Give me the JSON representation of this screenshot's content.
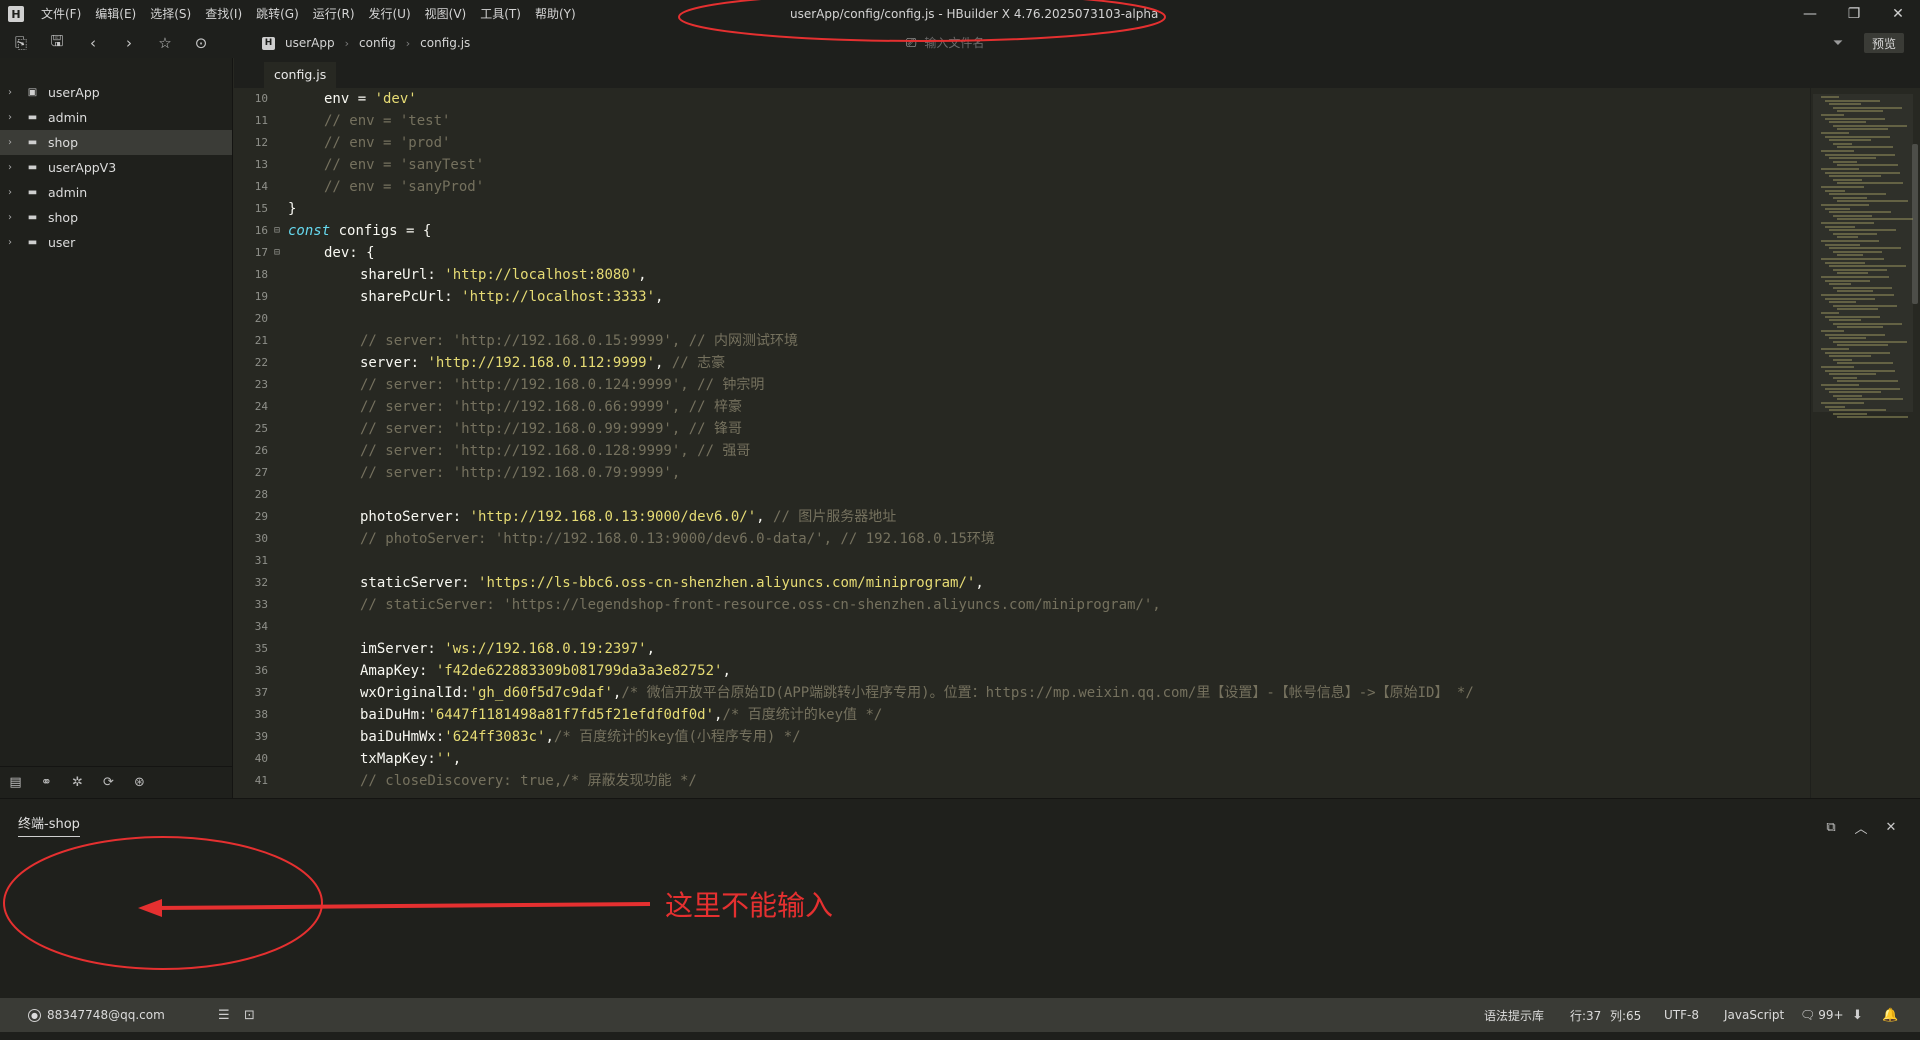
{
  "window": {
    "title": "userApp/config/config.js - HBuilder X 4.76.2025073103-alpha",
    "logo_letter": "H",
    "minimize": "—",
    "restore": "❐",
    "close": "✕"
  },
  "menu": [
    "文件(F)",
    "编辑(E)",
    "选择(S)",
    "查找(I)",
    "跳转(G)",
    "运行(R)",
    "发行(U)",
    "视图(V)",
    "工具(T)",
    "帮助(Y)"
  ],
  "toolbar": {
    "breadcrumb": [
      "userApp",
      "config",
      "config.js"
    ],
    "file_search_placeholder": "输入文件名",
    "preview_label": "预览"
  },
  "sidebar": {
    "items": [
      {
        "label": "userApp",
        "icon": "project-icon",
        "active": false
      },
      {
        "label": "admin",
        "icon": "folder-icon",
        "active": false
      },
      {
        "label": "shop",
        "icon": "folder-icon",
        "active": true
      },
      {
        "label": "userAppV3",
        "icon": "folder-icon",
        "active": false
      },
      {
        "label": "admin",
        "icon": "folder-icon",
        "active": false
      },
      {
        "label": "shop",
        "icon": "folder-icon",
        "active": false
      },
      {
        "label": "user",
        "icon": "folder-icon",
        "active": false
      }
    ]
  },
  "editor": {
    "tab": "config.js",
    "lines": [
      {
        "n": "10",
        "fold": "",
        "indent": 2,
        "parts": [
          [
            "k",
            "env = "
          ],
          [
            "s",
            "'dev'"
          ]
        ]
      },
      {
        "n": "11",
        "fold": "",
        "indent": 2,
        "parts": [
          [
            "c",
            "// env = 'test'"
          ]
        ]
      },
      {
        "n": "12",
        "fold": "",
        "indent": 2,
        "parts": [
          [
            "c",
            "// env = 'prod'"
          ]
        ]
      },
      {
        "n": "13",
        "fold": "",
        "indent": 2,
        "parts": [
          [
            "c",
            "// env = 'sanyTest'"
          ]
        ]
      },
      {
        "n": "14",
        "fold": "",
        "indent": 2,
        "parts": [
          [
            "c",
            "// env = 'sanyProd'"
          ]
        ]
      },
      {
        "n": "15",
        "fold": "",
        "indent": 0,
        "parts": [
          [
            "k",
            "}"
          ]
        ]
      },
      {
        "n": "16",
        "fold": "⊟",
        "indent": 0,
        "parts": [
          [
            "w",
            "const"
          ],
          [
            "k",
            " configs = {"
          ]
        ]
      },
      {
        "n": "17",
        "fold": "⊟",
        "indent": 2,
        "parts": [
          [
            "k",
            "dev: {"
          ]
        ]
      },
      {
        "n": "18",
        "fold": "",
        "indent": 4,
        "parts": [
          [
            "k",
            "shareUrl: "
          ],
          [
            "s",
            "'http://localhost:8080'"
          ],
          [
            "k",
            ","
          ]
        ]
      },
      {
        "n": "19",
        "fold": "",
        "indent": 4,
        "parts": [
          [
            "k",
            "sharePcUrl: "
          ],
          [
            "s",
            "'http://localhost:3333'"
          ],
          [
            "k",
            ","
          ]
        ]
      },
      {
        "n": "20",
        "fold": "",
        "indent": 0,
        "parts": []
      },
      {
        "n": "21",
        "fold": "",
        "indent": 4,
        "parts": [
          [
            "c",
            "// server: 'http://192.168.0.15:9999', // 内网测试环境"
          ]
        ]
      },
      {
        "n": "22",
        "fold": "",
        "indent": 4,
        "parts": [
          [
            "k",
            "server: "
          ],
          [
            "s",
            "'http://192.168.0.112:9999'"
          ],
          [
            "k",
            ", "
          ],
          [
            "c",
            "// 志豪"
          ]
        ]
      },
      {
        "n": "23",
        "fold": "",
        "indent": 4,
        "parts": [
          [
            "c",
            "// server: 'http://192.168.0.124:9999', // 钟宗明"
          ]
        ]
      },
      {
        "n": "24",
        "fold": "",
        "indent": 4,
        "parts": [
          [
            "c",
            "// server: 'http://192.168.0.66:9999', // 梓豪"
          ]
        ]
      },
      {
        "n": "25",
        "fold": "",
        "indent": 4,
        "parts": [
          [
            "c",
            "// server: 'http://192.168.0.99:9999', // 锋哥"
          ]
        ]
      },
      {
        "n": "26",
        "fold": "",
        "indent": 4,
        "parts": [
          [
            "c",
            "// server: 'http://192.168.0.128:9999', // 强哥"
          ]
        ]
      },
      {
        "n": "27",
        "fold": "",
        "indent": 4,
        "parts": [
          [
            "c",
            "// server: 'http://192.168.0.79:9999',"
          ]
        ]
      },
      {
        "n": "28",
        "fold": "",
        "indent": 0,
        "parts": []
      },
      {
        "n": "29",
        "fold": "",
        "indent": 4,
        "parts": [
          [
            "k",
            "photoServer: "
          ],
          [
            "s",
            "'http://192.168.0.13:9000/dev6.0/'"
          ],
          [
            "k",
            ", "
          ],
          [
            "c",
            "// 图片服务器地址"
          ]
        ]
      },
      {
        "n": "30",
        "fold": "",
        "indent": 4,
        "parts": [
          [
            "c",
            "// photoServer: 'http://192.168.0.13:9000/dev6.0-data/', // 192.168.0.15环境"
          ]
        ]
      },
      {
        "n": "31",
        "fold": "",
        "indent": 0,
        "parts": []
      },
      {
        "n": "32",
        "fold": "",
        "indent": 4,
        "parts": [
          [
            "k",
            "staticServer: "
          ],
          [
            "s",
            "'https://ls-bbc6.oss-cn-shenzhen.aliyuncs.com/miniprogram/'"
          ],
          [
            "k",
            ","
          ]
        ]
      },
      {
        "n": "33",
        "fold": "",
        "indent": 4,
        "parts": [
          [
            "c",
            "// staticServer: 'https://legendshop-front-resource.oss-cn-shenzhen.aliyuncs.com/miniprogram/',"
          ]
        ]
      },
      {
        "n": "34",
        "fold": "",
        "indent": 0,
        "parts": []
      },
      {
        "n": "35",
        "fold": "",
        "indent": 4,
        "parts": [
          [
            "k",
            "imServer: "
          ],
          [
            "s",
            "'ws://192.168.0.19:2397'"
          ],
          [
            "k",
            ","
          ]
        ]
      },
      {
        "n": "36",
        "fold": "",
        "indent": 4,
        "parts": [
          [
            "k",
            "AmapKey: "
          ],
          [
            "s",
            "'f42de622883309b081799da3a3e82752'"
          ],
          [
            "k",
            ","
          ]
        ]
      },
      {
        "n": "37",
        "fold": "",
        "indent": 4,
        "parts": [
          [
            "k",
            "wxOriginalId:"
          ],
          [
            "s",
            "'gh_d60f5d7c9daf'"
          ],
          [
            "k",
            ","
          ],
          [
            "c",
            "/* 微信开放平台原始ID(APP端跳转小程序专用)。位置：https://mp.weixin.qq.com/里【设置】-【帐号信息】->【原始ID】 */"
          ]
        ]
      },
      {
        "n": "38",
        "fold": "",
        "indent": 4,
        "parts": [
          [
            "k",
            "baiDuHm:"
          ],
          [
            "s",
            "'6447f1181498a81f7fd5f21efdf0df0d'"
          ],
          [
            "k",
            ","
          ],
          [
            "c",
            "/* 百度统计的key值 */"
          ]
        ]
      },
      {
        "n": "39",
        "fold": "",
        "indent": 4,
        "parts": [
          [
            "k",
            "baiDuHmWx:"
          ],
          [
            "s",
            "'624ff3083c'"
          ],
          [
            "k",
            ","
          ],
          [
            "c",
            "/* 百度统计的key值(小程序专用) */"
          ]
        ]
      },
      {
        "n": "40",
        "fold": "",
        "indent": 4,
        "parts": [
          [
            "k",
            "txMapKey:"
          ],
          [
            "s",
            "''"
          ],
          [
            "k",
            ","
          ]
        ]
      },
      {
        "n": "41",
        "fold": "",
        "indent": 4,
        "parts": [
          [
            "c",
            "// closeDiscovery: true,/* 屏蔽发现功能 */"
          ]
        ]
      }
    ]
  },
  "terminal": {
    "tab": "终端-shop"
  },
  "annotation": {
    "text": "这里不能输入",
    "color": "#e53030"
  },
  "statusbar": {
    "user": "88347748@qq.com",
    "syntax_lib": "语法提示库",
    "line": "行:37",
    "col": "列:65",
    "encoding": "UTF-8",
    "language": "JavaScript",
    "notifications": "99+"
  },
  "colors": {
    "background": "#272822",
    "comment": "#75715e",
    "string": "#e6db74",
    "keyword": "#66d9ef"
  }
}
